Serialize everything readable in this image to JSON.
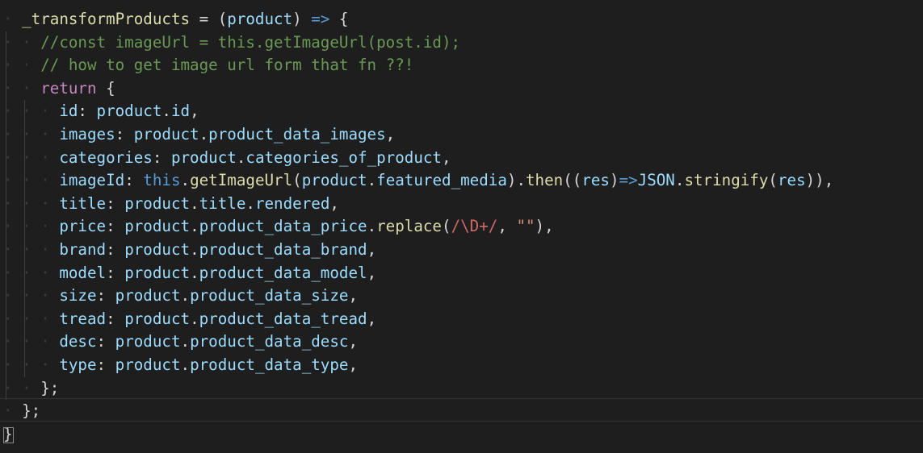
{
  "colors": {
    "background": "#1e1e1e",
    "keyword": "#c586c0",
    "function": "#dcdcaa",
    "property": "#9cdcfe",
    "operator": "#d4d4d4",
    "comment": "#6a9955",
    "string": "#ce9178",
    "regex": "#d16969",
    "this_keyword": "#569cd6",
    "object": "#4ec9b0",
    "whitespace": "#3b3b3b"
  },
  "code": {
    "lines": [
      {
        "indent": 1,
        "tokens": [
          {
            "t": "_transformProducts",
            "c": "function"
          },
          {
            "t": " = ",
            "c": "operator"
          },
          {
            "t": "(",
            "c": "operator"
          },
          {
            "t": "product",
            "c": "property"
          },
          {
            "t": ") ",
            "c": "operator"
          },
          {
            "t": "=>",
            "c": "this_keyword"
          },
          {
            "t": " {",
            "c": "operator"
          }
        ]
      },
      {
        "indent": 2,
        "tokens": [
          {
            "t": "//const imageUrl = this.getImageUrl(post.id);",
            "c": "comment"
          }
        ]
      },
      {
        "indent": 2,
        "tokens": [
          {
            "t": "// how to get image url form that fn ??!",
            "c": "comment"
          }
        ]
      },
      {
        "indent": 2,
        "tokens": [
          {
            "t": "return",
            "c": "keyword"
          },
          {
            "t": " {",
            "c": "operator"
          }
        ]
      },
      {
        "indent": 3,
        "tokens": [
          {
            "t": "id",
            "c": "property"
          },
          {
            "t": ": ",
            "c": "operator"
          },
          {
            "t": "product",
            "c": "property"
          },
          {
            "t": ".",
            "c": "operator"
          },
          {
            "t": "id",
            "c": "property"
          },
          {
            "t": ",",
            "c": "operator"
          }
        ]
      },
      {
        "indent": 3,
        "tokens": [
          {
            "t": "images",
            "c": "property"
          },
          {
            "t": ": ",
            "c": "operator"
          },
          {
            "t": "product",
            "c": "property"
          },
          {
            "t": ".",
            "c": "operator"
          },
          {
            "t": "product_data_images",
            "c": "property"
          },
          {
            "t": ",",
            "c": "operator"
          }
        ]
      },
      {
        "indent": 3,
        "tokens": [
          {
            "t": "categories",
            "c": "property"
          },
          {
            "t": ": ",
            "c": "operator"
          },
          {
            "t": "product",
            "c": "property"
          },
          {
            "t": ".",
            "c": "operator"
          },
          {
            "t": "categories_of_product",
            "c": "property"
          },
          {
            "t": ",",
            "c": "operator"
          }
        ]
      },
      {
        "indent": 3,
        "tokens": [
          {
            "t": "imageId",
            "c": "property"
          },
          {
            "t": ": ",
            "c": "operator"
          },
          {
            "t": "this",
            "c": "this_keyword"
          },
          {
            "t": ".",
            "c": "operator"
          },
          {
            "t": "getImageUrl",
            "c": "function"
          },
          {
            "t": "(",
            "c": "operator"
          },
          {
            "t": "product",
            "c": "property"
          },
          {
            "t": ".",
            "c": "operator"
          },
          {
            "t": "featured_media",
            "c": "property"
          },
          {
            "t": ").",
            "c": "operator"
          },
          {
            "t": "then",
            "c": "function"
          },
          {
            "t": "((",
            "c": "operator"
          },
          {
            "t": "res",
            "c": "property"
          },
          {
            "t": ")",
            "c": "operator"
          },
          {
            "t": "=>",
            "c": "this_keyword"
          },
          {
            "t": "JSON",
            "c": "property"
          },
          {
            "t": ".",
            "c": "operator"
          },
          {
            "t": "stringify",
            "c": "function"
          },
          {
            "t": "(",
            "c": "operator"
          },
          {
            "t": "res",
            "c": "property"
          },
          {
            "t": ")),",
            "c": "operator"
          }
        ]
      },
      {
        "indent": 3,
        "tokens": [
          {
            "t": "title",
            "c": "property"
          },
          {
            "t": ": ",
            "c": "operator"
          },
          {
            "t": "product",
            "c": "property"
          },
          {
            "t": ".",
            "c": "operator"
          },
          {
            "t": "title",
            "c": "property"
          },
          {
            "t": ".",
            "c": "operator"
          },
          {
            "t": "rendered",
            "c": "property"
          },
          {
            "t": ",",
            "c": "operator"
          }
        ]
      },
      {
        "indent": 3,
        "tokens": [
          {
            "t": "price",
            "c": "property"
          },
          {
            "t": ": ",
            "c": "operator"
          },
          {
            "t": "product",
            "c": "property"
          },
          {
            "t": ".",
            "c": "operator"
          },
          {
            "t": "product_data_price",
            "c": "property"
          },
          {
            "t": ".",
            "c": "operator"
          },
          {
            "t": "replace",
            "c": "function"
          },
          {
            "t": "(",
            "c": "operator"
          },
          {
            "t": "/\\D+/",
            "c": "regex"
          },
          {
            "t": ", ",
            "c": "operator"
          },
          {
            "t": "\"\"",
            "c": "string"
          },
          {
            "t": "),",
            "c": "operator"
          }
        ]
      },
      {
        "indent": 3,
        "tokens": [
          {
            "t": "brand",
            "c": "property"
          },
          {
            "t": ": ",
            "c": "operator"
          },
          {
            "t": "product",
            "c": "property"
          },
          {
            "t": ".",
            "c": "operator"
          },
          {
            "t": "product_data_brand",
            "c": "property"
          },
          {
            "t": ",",
            "c": "operator"
          }
        ]
      },
      {
        "indent": 3,
        "tokens": [
          {
            "t": "model",
            "c": "property"
          },
          {
            "t": ": ",
            "c": "operator"
          },
          {
            "t": "product",
            "c": "property"
          },
          {
            "t": ".",
            "c": "operator"
          },
          {
            "t": "product_data_model",
            "c": "property"
          },
          {
            "t": ",",
            "c": "operator"
          }
        ]
      },
      {
        "indent": 3,
        "tokens": [
          {
            "t": "size",
            "c": "property"
          },
          {
            "t": ": ",
            "c": "operator"
          },
          {
            "t": "product",
            "c": "property"
          },
          {
            "t": ".",
            "c": "operator"
          },
          {
            "t": "product_data_size",
            "c": "property"
          },
          {
            "t": ",",
            "c": "operator"
          }
        ]
      },
      {
        "indent": 3,
        "tokens": [
          {
            "t": "tread",
            "c": "property"
          },
          {
            "t": ": ",
            "c": "operator"
          },
          {
            "t": "product",
            "c": "property"
          },
          {
            "t": ".",
            "c": "operator"
          },
          {
            "t": "product_data_tread",
            "c": "property"
          },
          {
            "t": ",",
            "c": "operator"
          }
        ]
      },
      {
        "indent": 3,
        "tokens": [
          {
            "t": "desc",
            "c": "property"
          },
          {
            "t": ": ",
            "c": "operator"
          },
          {
            "t": "product",
            "c": "property"
          },
          {
            "t": ".",
            "c": "operator"
          },
          {
            "t": "product_data_desc",
            "c": "property"
          },
          {
            "t": ",",
            "c": "operator"
          }
        ]
      },
      {
        "indent": 3,
        "tokens": [
          {
            "t": "type",
            "c": "property"
          },
          {
            "t": ": ",
            "c": "operator"
          },
          {
            "t": "product",
            "c": "property"
          },
          {
            "t": ".",
            "c": "operator"
          },
          {
            "t": "product_data_type",
            "c": "property"
          },
          {
            "t": ",",
            "c": "operator"
          }
        ]
      },
      {
        "indent": 2,
        "tokens": [
          {
            "t": "};",
            "c": "operator"
          }
        ]
      },
      {
        "indent": 1,
        "tokens": [
          {
            "t": "};",
            "c": "operator"
          }
        ]
      },
      {
        "indent": 0,
        "tokens": [
          {
            "t": "}",
            "c": "operator"
          }
        ]
      }
    ]
  }
}
